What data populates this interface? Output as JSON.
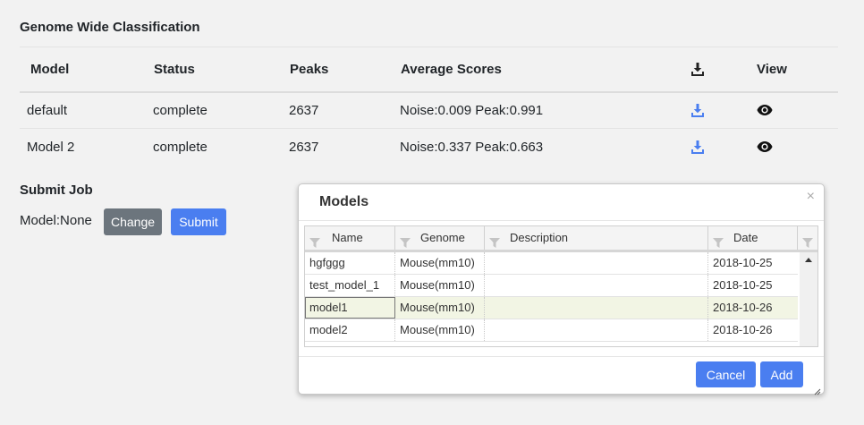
{
  "classification": {
    "title": "Genome Wide Classification",
    "columns": {
      "model": "Model",
      "status": "Status",
      "peaks": "Peaks",
      "avg": "Average Scores",
      "download_icon": "download-icon",
      "view": "View"
    },
    "rows": [
      {
        "model": "default",
        "status": "complete",
        "peaks": "2637",
        "avg": "Noise:0.009 Peak:0.991"
      },
      {
        "model": "Model 2",
        "status": "complete",
        "peaks": "2637",
        "avg": "Noise:0.337 Peak:0.663"
      }
    ]
  },
  "submit": {
    "title": "Submit Job",
    "model_label": "Model:None",
    "change_label": "Change",
    "submit_label": "Submit"
  },
  "dialog": {
    "title": "Models",
    "close": "×",
    "columns": {
      "name": "Name",
      "genome": "Genome",
      "description": "Description",
      "date": "Date"
    },
    "rows": [
      {
        "name": "hgfggg",
        "genome": "Mouse(mm10)",
        "description": "",
        "date": "2018-10-25"
      },
      {
        "name": "test_model_1",
        "genome": "Mouse(mm10)",
        "description": "",
        "date": "2018-10-25"
      },
      {
        "name": "model1",
        "genome": "Mouse(mm10)",
        "description": "",
        "date": "2018-10-26",
        "selected": true
      },
      {
        "name": "model2",
        "genome": "Mouse(mm10)",
        "description": "",
        "date": "2018-10-26"
      }
    ],
    "cancel_label": "Cancel",
    "add_label": "Add"
  },
  "colors": {
    "primary": "#4a7ef0",
    "secondary": "#6c757d",
    "selected_row": "#f2f5e4",
    "background": "#f2f2f2"
  },
  "icons": {
    "download": "download-icon",
    "view": "eye-icon",
    "filter": "filter-icon",
    "close": "close-icon",
    "scroll_up": "arrow-up-icon",
    "resize": "resize-grip-icon"
  }
}
